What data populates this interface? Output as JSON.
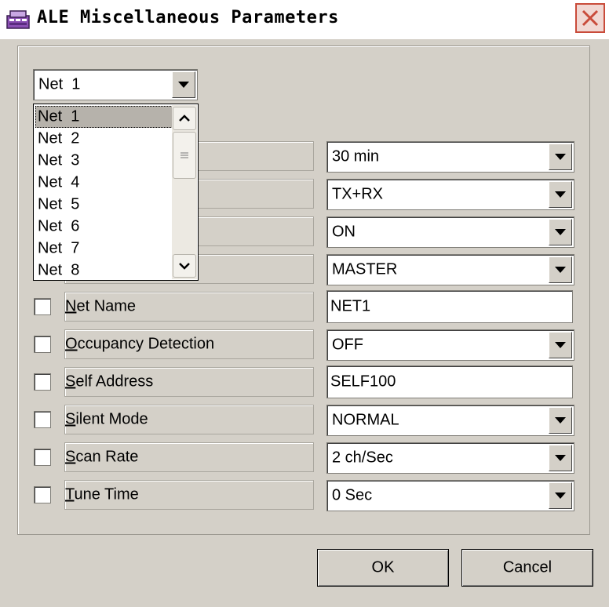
{
  "window": {
    "title": "ALE Miscellaneous Parameters",
    "close_icon": "close-icon"
  },
  "net_selector": {
    "value": "Net  1",
    "options": [
      "Net  1",
      "Net  2",
      "Net  3",
      "Net  4",
      "Net  5",
      "Net  6",
      "Net  7",
      "Net  8"
    ],
    "selected_index": 0
  },
  "parameters": [
    {
      "label": "",
      "value": "30 min",
      "control": "combo"
    },
    {
      "label": "",
      "value": "TX+RX",
      "control": "combo"
    },
    {
      "label": "",
      "value": "ON",
      "control": "combo"
    },
    {
      "label": "",
      "value": "MASTER",
      "control": "combo"
    },
    {
      "label_first": "N",
      "label_rest": "et Name",
      "value": "NET1",
      "control": "text"
    },
    {
      "label_first": "O",
      "label_rest": "ccupancy Detection",
      "value": "OFF",
      "control": "combo"
    },
    {
      "label_first": "S",
      "label_rest": "elf Address",
      "value": "SELF100",
      "control": "text"
    },
    {
      "label_first": "S",
      "label_rest": "ilent Mode",
      "value": "NORMAL",
      "control": "combo"
    },
    {
      "label_first": "S",
      "label_rest": "can Rate",
      "value": "2 ch/Sec",
      "control": "combo"
    },
    {
      "label_first": "T",
      "label_rest": "une Time",
      "value": "0 Sec",
      "control": "combo"
    }
  ],
  "buttons": {
    "ok_label": "OK",
    "cancel_label": "Cancel"
  },
  "colors": {
    "dialog_bg": "#d4d0c8",
    "close_border": "#c94b3a"
  }
}
